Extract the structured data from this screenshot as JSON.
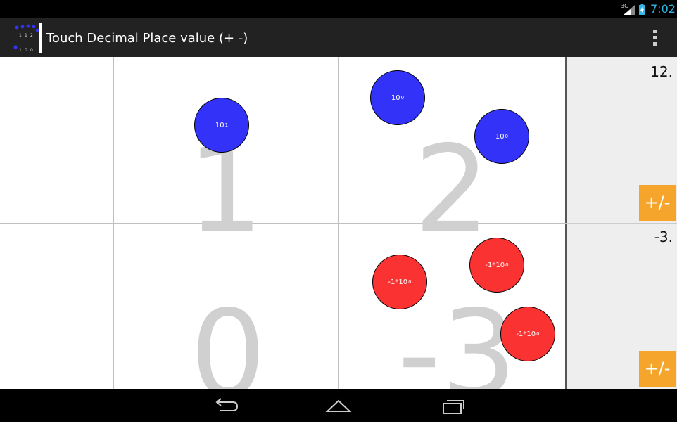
{
  "status_bar": {
    "network": "3G",
    "time": "7:02"
  },
  "action_bar": {
    "title": "Touch Decimal Place value (+ -)",
    "app_icon": "place-value-counters-icon",
    "app_icon_digits": [
      "1",
      "1",
      "2",
      "1",
      "0",
      "0"
    ],
    "overflow_icon": "overflow-menu-icon"
  },
  "rows": [
    {
      "digits": [
        "",
        "1",
        "2"
      ],
      "total": "12.",
      "sign_button": "+/-",
      "chips": [
        {
          "column": "tens",
          "base": "10",
          "exponent": "1",
          "color": "blue"
        },
        {
          "column": "ones",
          "base": "10",
          "exponent": "0",
          "color": "blue"
        },
        {
          "column": "ones",
          "base": "10",
          "exponent": "0",
          "color": "blue"
        }
      ]
    },
    {
      "digits": [
        "",
        "0",
        "-3"
      ],
      "total": "-3.",
      "sign_button": "+/-",
      "chips": [
        {
          "column": "ones",
          "base": "-1*10",
          "exponent": "0",
          "color": "red"
        },
        {
          "column": "ones",
          "base": "-1*10",
          "exponent": "0",
          "color": "red"
        },
        {
          "column": "ones",
          "base": "-1*10",
          "exponent": "0",
          "color": "red"
        }
      ]
    }
  ],
  "colors": {
    "positive_chip": "#3232f8",
    "negative_chip": "#fa3232",
    "sign_button": "#f6a52c",
    "digit": "#d0d0d0",
    "clock": "#33b5e5"
  },
  "nav_bar": {
    "buttons": [
      "back-icon",
      "home-icon",
      "recent-apps-icon"
    ]
  }
}
